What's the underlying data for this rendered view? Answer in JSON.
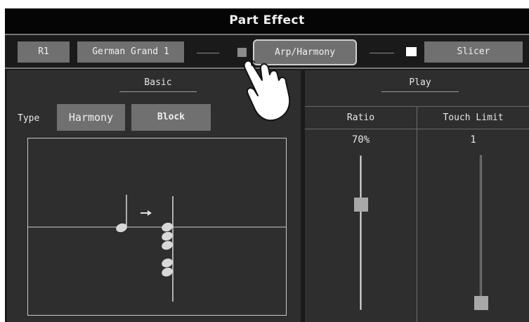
{
  "window": {
    "title": "Part Effect"
  },
  "part_bar": {
    "part_label": "R1",
    "voice_name": "German Grand 1",
    "arp_harmony_label": "Arp/Harmony",
    "slicer_label": "Slicer"
  },
  "basic": {
    "title": "Basic",
    "type_label": "Type",
    "type_value": "Harmony",
    "mode_value": "Block"
  },
  "play": {
    "title": "Play",
    "ratio_label": "Ratio",
    "ratio_value": "70%",
    "ratio_level": 0.7,
    "touch_limit_label": "Touch Limit",
    "touch_limit_value": "1",
    "touch_limit_level": 0.0
  },
  "colors": {
    "background": "#1a1a1a",
    "panel": "#2e2e2e",
    "button": "#707070",
    "highlight_border": "#d0d0d0"
  },
  "icons": [
    "arrow-right-icon",
    "pointing-hand-icon",
    "note-icon"
  ]
}
